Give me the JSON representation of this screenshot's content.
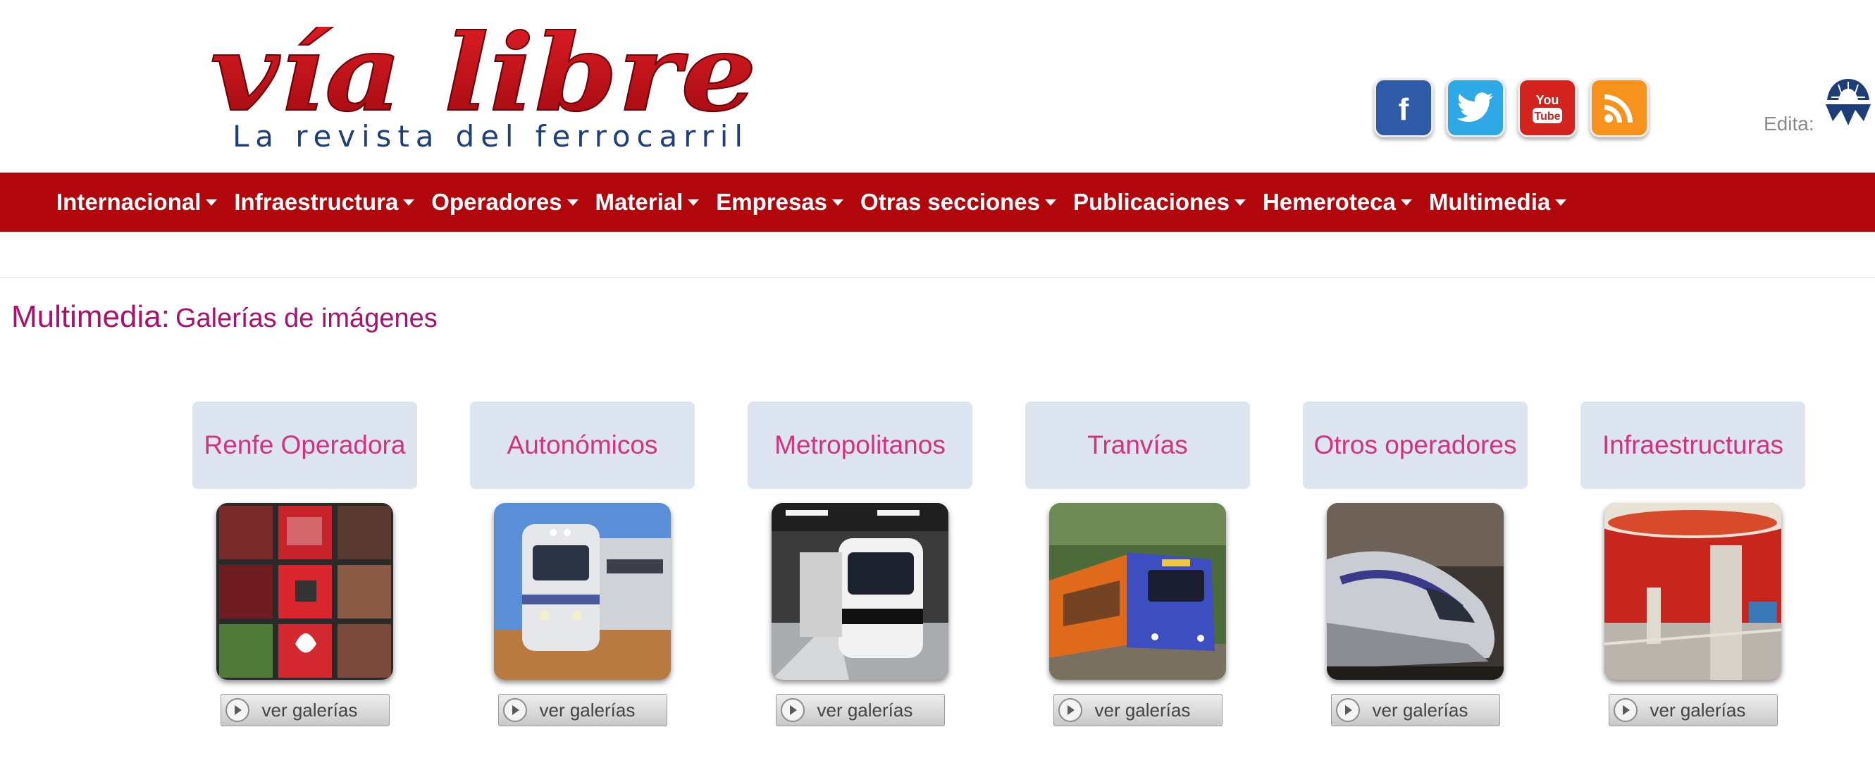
{
  "header": {
    "logo_name": "vía libre",
    "logo_tagline": "La revista del ferrocarril",
    "social": [
      {
        "icon": "facebook-icon",
        "color": "#2f5aa7",
        "glyph": "f"
      },
      {
        "icon": "twitter-icon",
        "color": "#2ea9e6"
      },
      {
        "icon": "youtube-icon",
        "color": "#d4231c",
        "glyph_top": "You",
        "glyph_bottom": "Tube"
      },
      {
        "icon": "rss-icon",
        "color": "#f7931d"
      }
    ],
    "edita_label": "Edita:"
  },
  "nav": {
    "items": [
      {
        "label": "Internacional"
      },
      {
        "label": "Infraestructura"
      },
      {
        "label": "Operadores"
      },
      {
        "label": "Material"
      },
      {
        "label": "Empresas"
      },
      {
        "label": "Otras secciones"
      },
      {
        "label": "Publicaciones"
      },
      {
        "label": "Hemeroteca"
      },
      {
        "label": "Multimedia"
      }
    ]
  },
  "heading": {
    "main": "Multimedia:",
    "sub": "Galerías de imágenes"
  },
  "galleries": [
    {
      "title": "Renfe Operadora",
      "button": "ver galerías"
    },
    {
      "title": "Autonómicos",
      "button": "ver galerías"
    },
    {
      "title": "Metropolitanos",
      "button": "ver galerías"
    },
    {
      "title": "Tranvías",
      "button": "ver galerías"
    },
    {
      "title": "Otros operadores",
      "button": "ver galerías"
    },
    {
      "title": "Infraestructuras",
      "button": "ver galerías"
    }
  ],
  "colors": {
    "brand_red": "#b1060c",
    "heading_magenta": "#a8116e",
    "category_pink": "#d4317f",
    "category_bg": "#dce5f0"
  }
}
